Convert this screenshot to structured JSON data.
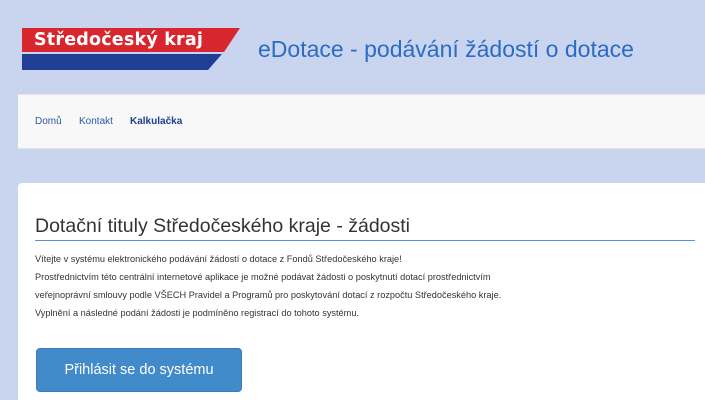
{
  "header": {
    "logo_text": "Středočeský kraj",
    "app_title": "eDotace - podávání žádostí o dotace"
  },
  "nav": {
    "items": [
      {
        "label": "Domů",
        "active": false
      },
      {
        "label": "Kontakt",
        "active": false
      },
      {
        "label": "Kalkulačka",
        "active": true
      }
    ]
  },
  "main": {
    "title": "Dotační tituly Středočeského kraje - žádosti",
    "paragraphs": [
      "Vítejte v systému elektronického podávání žádostí o dotace z Fondů Středočeského kraje!",
      "Prostřednictvím této centrální internetové aplikace je možné podávat žádosti o poskytnutí dotací prostřednictvím",
      "veřejnoprávní smlouvy podle VŠECH Pravidel a Programů pro poskytování dotací z rozpočtu Středočeského kraje.",
      "Vyplnění a následné podání žádosti je podmíněno registrací do tohoto systému."
    ],
    "login_button": "Přihlásit se do systému"
  },
  "colors": {
    "page_background": "#c9d4ef",
    "logo_red": "#d7262d",
    "logo_blue": "#1f3f95",
    "app_title": "#2b6cc4",
    "button": "#428bca"
  }
}
